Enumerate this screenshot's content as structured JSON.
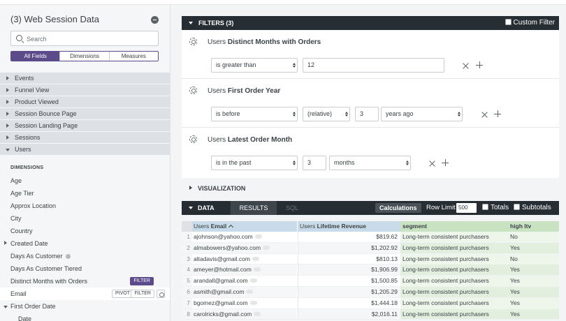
{
  "sidebar": {
    "title": "(3) Web Session Data",
    "search_placeholder": "Search",
    "tabs": [
      "All Fields",
      "Dimensions",
      "Measures"
    ],
    "views": [
      {
        "label": "Events",
        "open": false
      },
      {
        "label": "Funnel View",
        "open": false
      },
      {
        "label": "Product Viewed",
        "open": false
      },
      {
        "label": "Session Bounce Page",
        "open": false
      },
      {
        "label": "Session Landing Page",
        "open": false
      },
      {
        "label": "Sessions",
        "open": false
      },
      {
        "label": "Users",
        "open": true
      }
    ],
    "dimensions_header": "DIMENSIONS",
    "fields": {
      "age": "Age",
      "age_tier": "Age Tier",
      "approx_location": "Approx Location",
      "city": "City",
      "country": "Country",
      "created_date": "Created Date",
      "days_as_customer": "Days As Customer",
      "days_as_customer_tiered": "Days As Customer Tiered",
      "distinct_months": "Distinct Months with Orders",
      "email": "Email",
      "first_order_date": "First Order Date",
      "date": "Date"
    },
    "filter_badge": "FILTER",
    "pivot_btn": "PIVOT",
    "filter_btn": "FILTER"
  },
  "filters_bar": {
    "label": "FILTERS (3)",
    "custom_filter": "Custom Filter"
  },
  "filters": [
    {
      "view": "Users",
      "field": "Distinct Months with Orders",
      "operator": "is greater than",
      "value": "12"
    },
    {
      "view": "Users",
      "field": "First Order Year",
      "operator": "is before",
      "mode": "(relative)",
      "value": "3",
      "unit": "years ago"
    },
    {
      "view": "Users",
      "field": "Latest Order Month",
      "operator": "is in the past",
      "value": "3",
      "unit": "months"
    }
  ],
  "visualization": {
    "label": "VISUALIZATION"
  },
  "data_bar": {
    "label": "DATA",
    "results_tab": "RESULTS",
    "sql_tab": "SQL",
    "calculations": "Calculations",
    "row_limit_label": "Row Limit",
    "row_limit_value": "500",
    "totals": "Totals",
    "subtotals": "Subtotals"
  },
  "table": {
    "headers": {
      "email_view": "Users",
      "email_field": "Email",
      "ltv_view": "Users",
      "ltv_field": "Lifetime Revenue",
      "segment": "segment",
      "high_ltv": "high ltv"
    },
    "rows": [
      {
        "n": "1",
        "email": "ajohnson@yahoo.com",
        "revenue": "$819.62",
        "segment": "Long-term consistent purchasers",
        "high_ltv": "No"
      },
      {
        "n": "2",
        "email": "almabowers@yahoo.com",
        "revenue": "$1,202.92",
        "segment": "Long-term consistent purchasers",
        "high_ltv": "Yes"
      },
      {
        "n": "3",
        "email": "altadavis@gmail.com",
        "revenue": "$810.13",
        "segment": "Long-term consistent purchasers",
        "high_ltv": "No"
      },
      {
        "n": "4",
        "email": "ameyer@hotmail.com",
        "revenue": "$1,906.99",
        "segment": "Long-term consistent purchasers",
        "high_ltv": "Yes"
      },
      {
        "n": "5",
        "email": "arandall@gmail.com",
        "revenue": "$1,500.85",
        "segment": "Long-term consistent purchasers",
        "high_ltv": "Yes"
      },
      {
        "n": "6",
        "email": "asmith@gmail.com",
        "revenue": "$1,205.29",
        "segment": "Long-term consistent purchasers",
        "high_ltv": "Yes"
      },
      {
        "n": "7",
        "email": "bgomez@gmail.com",
        "revenue": "$1,444.18",
        "segment": "Long-term consistent purchasers",
        "high_ltv": "Yes"
      },
      {
        "n": "8",
        "email": "carolricks@gmail.com",
        "revenue": "$2,016.11",
        "segment": "Long-term consistent purchasers",
        "high_ltv": "Yes"
      }
    ]
  },
  "colors": {
    "accent": "#5b4b8a",
    "dark_bar": "#262d33",
    "dimension_header": "#c9dbe8",
    "calc_header": "#c9e3c2"
  }
}
